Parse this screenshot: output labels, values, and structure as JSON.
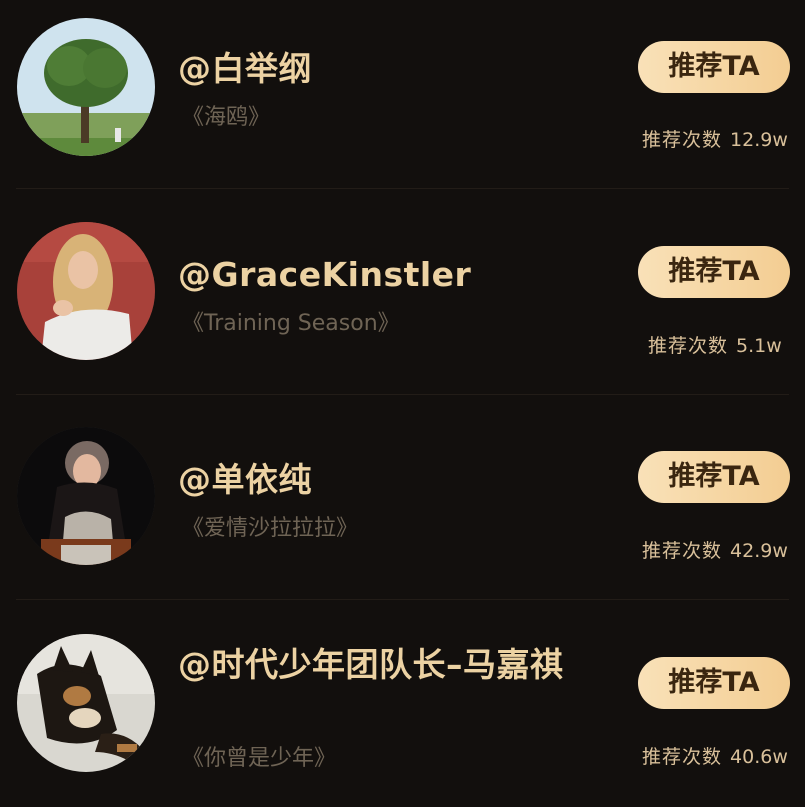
{
  "users": [
    {
      "name": "@白举纲",
      "song": "《海鸥》",
      "button_label": "推荐TA",
      "count_label": "推荐次数",
      "count_value": "12.9w",
      "avatar_icon": "tree-photo-avatar"
    },
    {
      "name": "@GraceKinstler",
      "song": "《Training Season》",
      "button_label": "推荐TA",
      "count_label": "推荐次数",
      "count_value": "5.1w",
      "avatar_icon": "woman-white-dress-avatar"
    },
    {
      "name": "@单依纯",
      "song": "《爱情沙拉拉拉》",
      "button_label": "推荐TA",
      "count_label": "推荐次数",
      "count_value": "42.9w",
      "avatar_icon": "singer-sequin-avatar"
    },
    {
      "name": "@时代少年团队长–马嘉祺",
      "song": "《你曾是少年》",
      "button_label": "推荐TA",
      "count_label": "推荐次数",
      "count_value": "40.6w",
      "avatar_icon": "shiba-dog-avatar"
    }
  ],
  "colors": {
    "background": "#120f0d",
    "name": "#ecd2a3",
    "button_gradient": [
      "#f9e1b8",
      "#f3cd92"
    ],
    "button_text": "#3a2610",
    "song": "#6f6455"
  }
}
